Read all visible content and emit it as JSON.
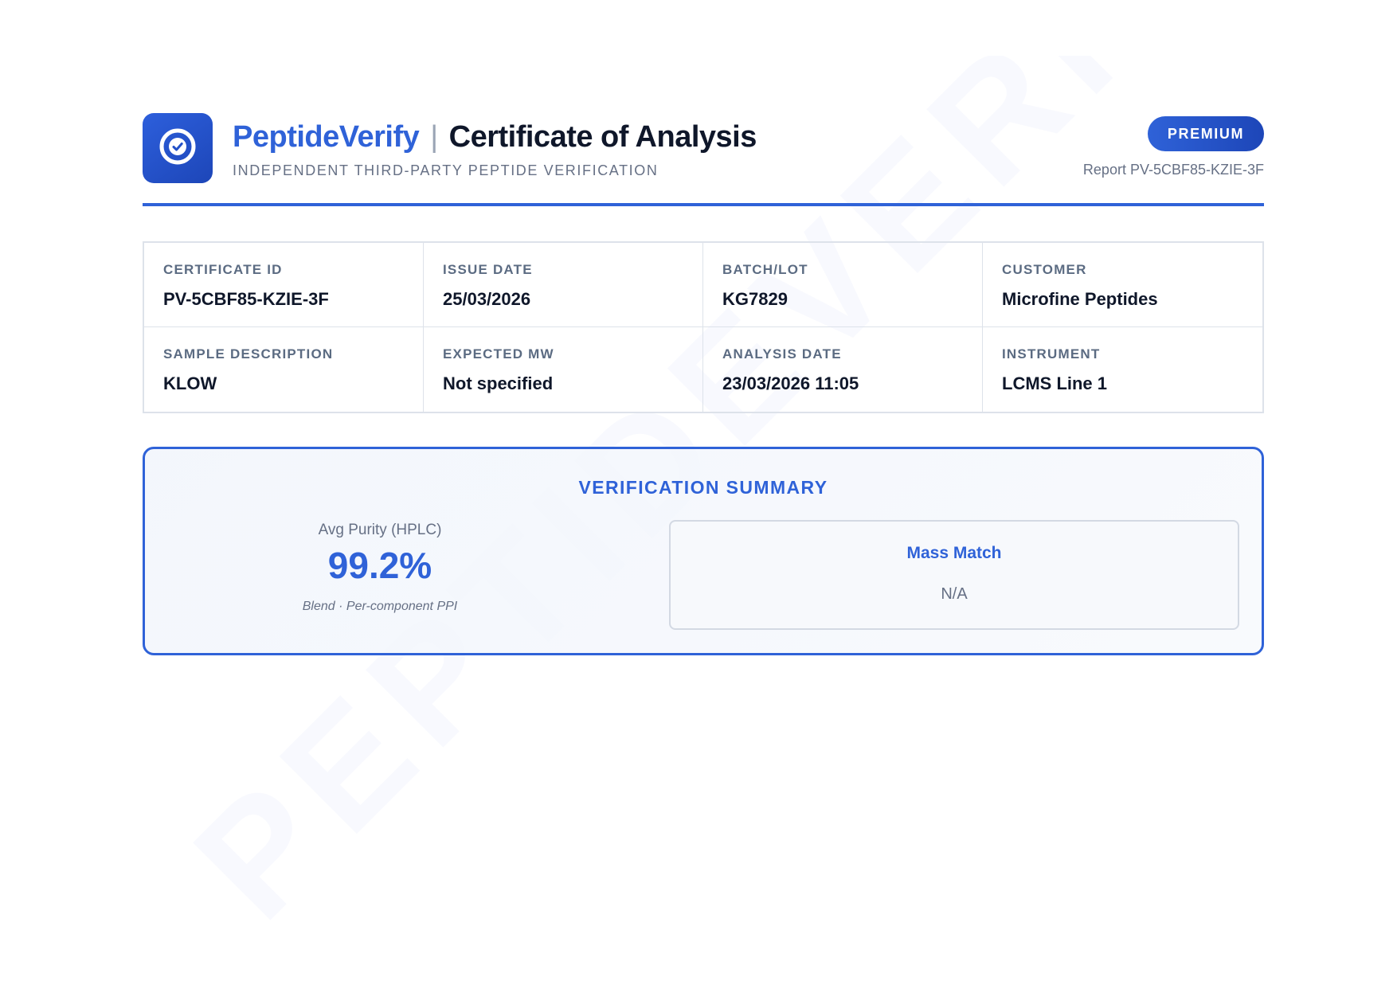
{
  "header": {
    "brand": "PeptideVerify",
    "separator": "|",
    "title": "Certificate of Analysis",
    "tagline": "INDEPENDENT THIRD-PARTY PEPTIDE VERIFICATION",
    "badge": "PREMIUM",
    "report_id": "Report PV-5CBF85-KZIE-3F",
    "logo_icon": "check-badge-icon"
  },
  "info": [
    {
      "label": "CERTIFICATE ID",
      "value": "PV-5CBF85-KZIE-3F"
    },
    {
      "label": "ISSUE DATE",
      "value": "25/03/2026"
    },
    {
      "label": "BATCH/LOT",
      "value": "KG7829"
    },
    {
      "label": "CUSTOMER",
      "value": "Microfine Peptides"
    },
    {
      "label": "SAMPLE DESCRIPTION",
      "value": "KLOW"
    },
    {
      "label": "EXPECTED MW",
      "value": "Not specified"
    },
    {
      "label": "ANALYSIS DATE",
      "value": "23/03/2026 11:05"
    },
    {
      "label": "INSTRUMENT",
      "value": "LCMS Line 1"
    }
  ],
  "summary": {
    "title": "VERIFICATION SUMMARY",
    "purity_label": "Avg Purity (HPLC)",
    "purity_value": "99.2%",
    "purity_note": "Blend · Per-component PPI",
    "mass_title": "Mass Match",
    "mass_value": "N/A"
  },
  "watermark": {
    "text": "PEPTIDEVERIFY"
  },
  "colors": {
    "accent": "#2f62d8",
    "accent_dark": "#1d46b8",
    "text_primary": "#0f172a",
    "text_muted": "#667085",
    "border": "#dde2ea"
  }
}
